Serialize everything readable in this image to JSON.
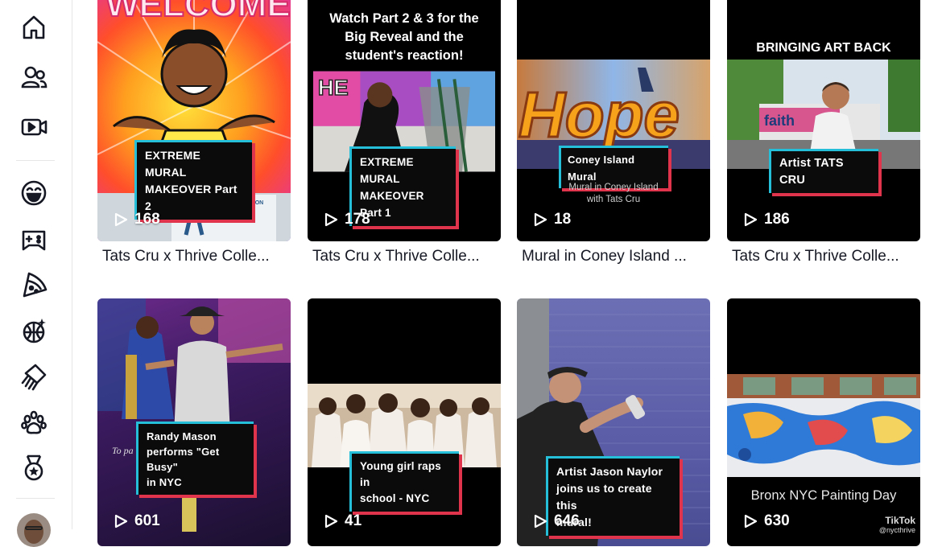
{
  "sidebar": {
    "items": [
      {
        "icon": "home-icon"
      },
      {
        "icon": "following-icon"
      },
      {
        "icon": "live-icon"
      },
      {
        "icon": "comedy-icon"
      },
      {
        "icon": "gaming-icon"
      },
      {
        "icon": "food-icon"
      },
      {
        "icon": "dance-icon"
      },
      {
        "icon": "beauty-icon"
      },
      {
        "icon": "animals-icon"
      },
      {
        "icon": "sports-icon"
      }
    ]
  },
  "videos": [
    {
      "views": "168",
      "caption": "Tats Cru x Thrive Colle...",
      "overlay": [
        "EXTREME MURAL",
        "MAKEOVER Part 2"
      ],
      "top_text": "WELCOME",
      "sign_text": [
        "ADULT EDUCATION",
        "WELCOME!"
      ]
    },
    {
      "views": "178",
      "caption": "Tats Cru x Thrive Colle...",
      "overlay": [
        "EXTREME MURAL",
        "MAKEOVER Part 1"
      ],
      "top_text": [
        "Watch Part 2 & 3 for the",
        "Big Reveal and the",
        "student's reaction!"
      ],
      "wall_text": "HE"
    },
    {
      "views": "18",
      "caption": "Mural in Coney Island ...",
      "overlay": [
        "Coney Island Mural"
      ],
      "subtext": [
        "Mural in Coney Island",
        "with Tats Cru"
      ],
      "wall_text": "Hope"
    },
    {
      "views": "186",
      "caption": "Tats Cru x Thrive Colle...",
      "overlay": [
        "Artist TATS CRU"
      ],
      "top_text": "BRINGING ART BACK"
    },
    {
      "views": "601",
      "overlay": [
        "Randy Mason",
        "performs \"Get Busy\"",
        "in NYC"
      ],
      "bg_text": "To pa"
    },
    {
      "views": "41",
      "overlay": [
        "Young girl raps in",
        "school - NYC"
      ]
    },
    {
      "views": "646",
      "overlay": [
        "Artist Jason Naylor",
        "joins us to create this",
        "mural!"
      ]
    },
    {
      "views": "630",
      "overlay": [
        "Bronx NYC Painting Day"
      ],
      "watermark": [
        "TikTok",
        "@nycthrive"
      ]
    }
  ],
  "colors": {
    "accent_cyan": "#25bfd9",
    "accent_red": "#e0344d",
    "text": "#161823"
  }
}
